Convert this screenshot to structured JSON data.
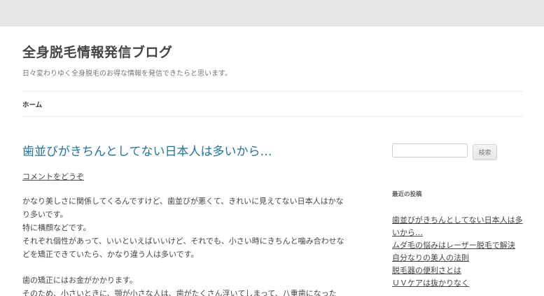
{
  "site": {
    "title": "全身脱毛情報発信ブログ",
    "description": "日々変わりゆく全身脱毛のお得な情報を発信できたらと思います。"
  },
  "nav": {
    "home_label": "ホーム"
  },
  "post": {
    "title": "歯並びがきちんとしてない日本人は多いから…",
    "comment_link": "コメントをどうぞ",
    "paragraphs": [
      "かなり美しさに関係してくるんですけど、歯並びが悪くて、きれいに見えてない日本人はかなり多いです。",
      "特に横顔などです。",
      "それぞれ個性があって、いいといえばいいけど、それでも、小さい時にきちんと噛み合わせなどを矯正できていたら、かなり違う人は多いです。",
      "",
      "歯の矯正にはお金がかかります。",
      "そのため、小さいときに、顎が小さな人は、歯がたくさん浮いてしまって、八重歯になった"
    ]
  },
  "sidebar": {
    "search_placeholder": "",
    "search_button": "検索",
    "recent_title": "最近の投稿",
    "recent_posts": [
      "歯並びがきちんとしてない日本人は多いから…",
      "ムダ毛の悩みはレーザー脱毛で解決",
      "自分なりの美人の法則",
      "脱毛器の便利さとは",
      "ＵＶケアは抜かりなく"
    ]
  },
  "colors": {
    "background": "#e6e6e6",
    "page": "#ffffff",
    "post_title": "#21759b",
    "text": "#444444"
  }
}
